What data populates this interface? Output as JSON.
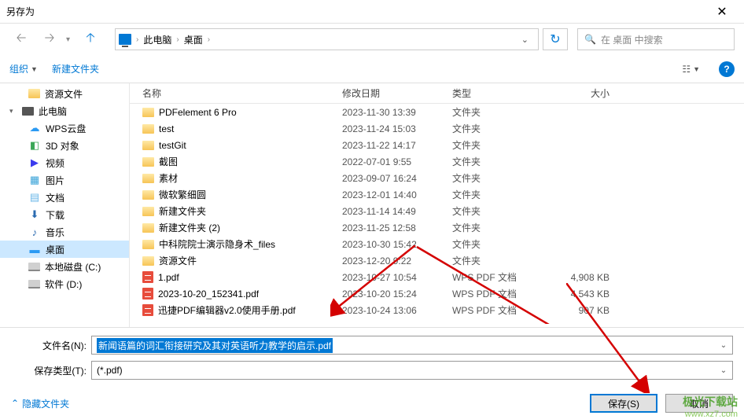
{
  "title": "另存为",
  "breadcrumb": {
    "root": "此电脑",
    "current": "桌面"
  },
  "search": {
    "placeholder": "在 桌面 中搜索"
  },
  "toolbar": {
    "organize": "组织",
    "new_folder": "新建文件夹"
  },
  "columns": {
    "name": "名称",
    "date": "修改日期",
    "type": "类型",
    "size": "大小"
  },
  "sidebar": [
    {
      "label": "资源文件",
      "icon": "folder",
      "indent": true
    },
    {
      "label": "此电脑",
      "icon": "pc",
      "indent": false,
      "expander": "▾"
    },
    {
      "label": "WPS云盘",
      "icon": "cloud",
      "indent": true,
      "color": "#2b9af3"
    },
    {
      "label": "3D 对象",
      "icon": "3d",
      "indent": true,
      "color": "#3aa757"
    },
    {
      "label": "视频",
      "icon": "video",
      "indent": true,
      "color": "#3a3aee"
    },
    {
      "label": "图片",
      "icon": "pic",
      "indent": true,
      "color": "#37a2d8"
    },
    {
      "label": "文档",
      "icon": "doc",
      "indent": true,
      "color": "#6ab7e8"
    },
    {
      "label": "下载",
      "icon": "download",
      "indent": true,
      "color": "#2b6bb0"
    },
    {
      "label": "音乐",
      "icon": "music",
      "indent": true,
      "color": "#2b6bb0"
    },
    {
      "label": "桌面",
      "icon": "desktop",
      "indent": true,
      "color": "#2b9af3",
      "selected": true
    },
    {
      "label": "本地磁盘 (C:)",
      "icon": "drive",
      "indent": true
    },
    {
      "label": "软件 (D:)",
      "icon": "drive",
      "indent": true
    }
  ],
  "files": [
    {
      "name": "PDFelement 6 Pro",
      "date": "2023-11-30 13:39",
      "type": "文件夹",
      "size": "",
      "kind": "folder"
    },
    {
      "name": "test",
      "date": "2023-11-24 15:03",
      "type": "文件夹",
      "size": "",
      "kind": "folder"
    },
    {
      "name": "testGit",
      "date": "2023-11-22 14:17",
      "type": "文件夹",
      "size": "",
      "kind": "folder"
    },
    {
      "name": "截图",
      "date": "2022-07-01 9:55",
      "type": "文件夹",
      "size": "",
      "kind": "folder"
    },
    {
      "name": "素材",
      "date": "2023-09-07 16:24",
      "type": "文件夹",
      "size": "",
      "kind": "folder"
    },
    {
      "name": "微软繁细圆",
      "date": "2023-12-01 14:40",
      "type": "文件夹",
      "size": "",
      "kind": "folder"
    },
    {
      "name": "新建文件夹",
      "date": "2023-11-14 14:49",
      "type": "文件夹",
      "size": "",
      "kind": "folder"
    },
    {
      "name": "新建文件夹 (2)",
      "date": "2023-11-25 12:58",
      "type": "文件夹",
      "size": "",
      "kind": "folder"
    },
    {
      "name": "中科院院士演示隐身术_files",
      "date": "2023-10-30 15:42",
      "type": "文件夹",
      "size": "",
      "kind": "folder"
    },
    {
      "name": "资源文件",
      "date": "2023-12-20 9:22",
      "type": "文件夹",
      "size": "",
      "kind": "folder"
    },
    {
      "name": "1.pdf",
      "date": "2023-10-27 10:54",
      "type": "WPS PDF 文档",
      "size": "4,908 KB",
      "kind": "pdf"
    },
    {
      "name": "2023-10-20_152341.pdf",
      "date": "2023-10-20 15:24",
      "type": "WPS PDF 文档",
      "size": "4,543 KB",
      "kind": "pdf"
    },
    {
      "name": "迅捷PDF编辑器v2.0使用手册.pdf",
      "date": "2023-10-24 13:06",
      "type": "WPS PDF 文档",
      "size": "907 KB",
      "kind": "pdf"
    }
  ],
  "filename": {
    "label": "文件名(N):",
    "value": "新闻语篇的词汇衔接研究及其对英语听力教学的启示.pdf"
  },
  "filetype": {
    "label": "保存类型(T):",
    "value": "(*.pdf)"
  },
  "footer": {
    "hide_folders": "隐藏文件夹",
    "save": "保存(S)",
    "cancel": "取消"
  },
  "watermark": {
    "name": "极光下载站",
    "url": "www.xz7.com"
  }
}
